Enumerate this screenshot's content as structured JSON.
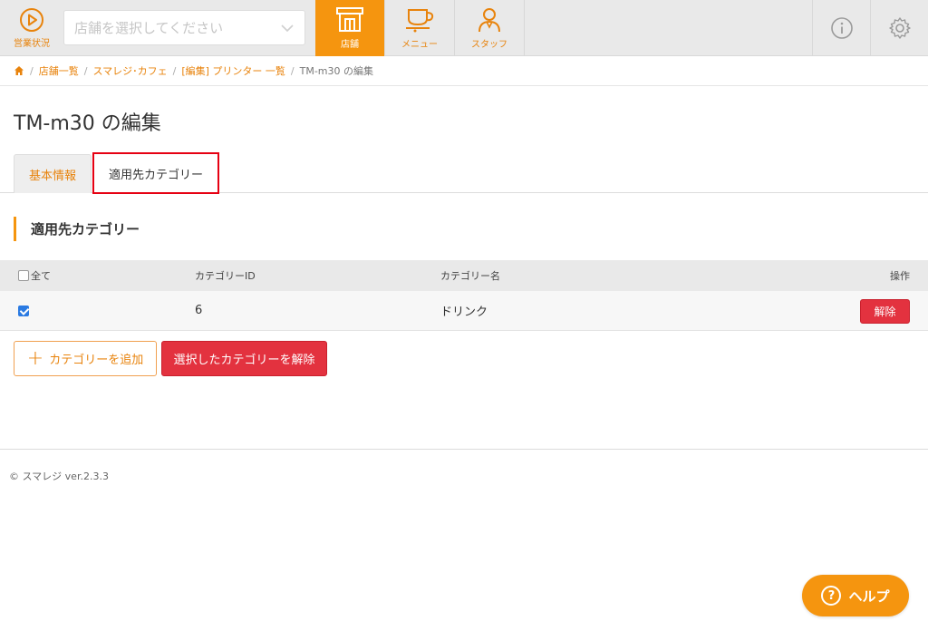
{
  "header": {
    "status_label": "営業状況",
    "store_placeholder": "店舗を選択してください",
    "nav": [
      {
        "label": "店舗",
        "active": true
      },
      {
        "label": "メニュー",
        "active": false
      },
      {
        "label": "スタッフ",
        "active": false
      }
    ],
    "accent_color": "#f5950f"
  },
  "breadcrumb": {
    "items": [
      "店舗一覧",
      "スマレジ･カフェ",
      "[編集] プリンター 一覧"
    ],
    "current": "TM-m30 の編集"
  },
  "page": {
    "title": "TM-m30 の編集"
  },
  "tabs": [
    {
      "label": "基本情報",
      "selected": false
    },
    {
      "label": "適用先カテゴリー",
      "selected": true
    }
  ],
  "section": {
    "title": "適用先カテゴリー"
  },
  "table": {
    "headers": {
      "all": "全て",
      "category_id": "カテゴリーID",
      "category_name": "カテゴリー名",
      "action": "操作"
    },
    "rows": [
      {
        "checked": true,
        "category_id": "6",
        "category_name": "ドリンク",
        "action_label": "解除"
      }
    ]
  },
  "actions": {
    "add_label": "カテゴリーを追加",
    "remove_selected_label": "選択したカテゴリーを解除"
  },
  "footer": {
    "text": "© スマレジ ver.2.3.3"
  },
  "help": {
    "label": "ヘルプ"
  }
}
